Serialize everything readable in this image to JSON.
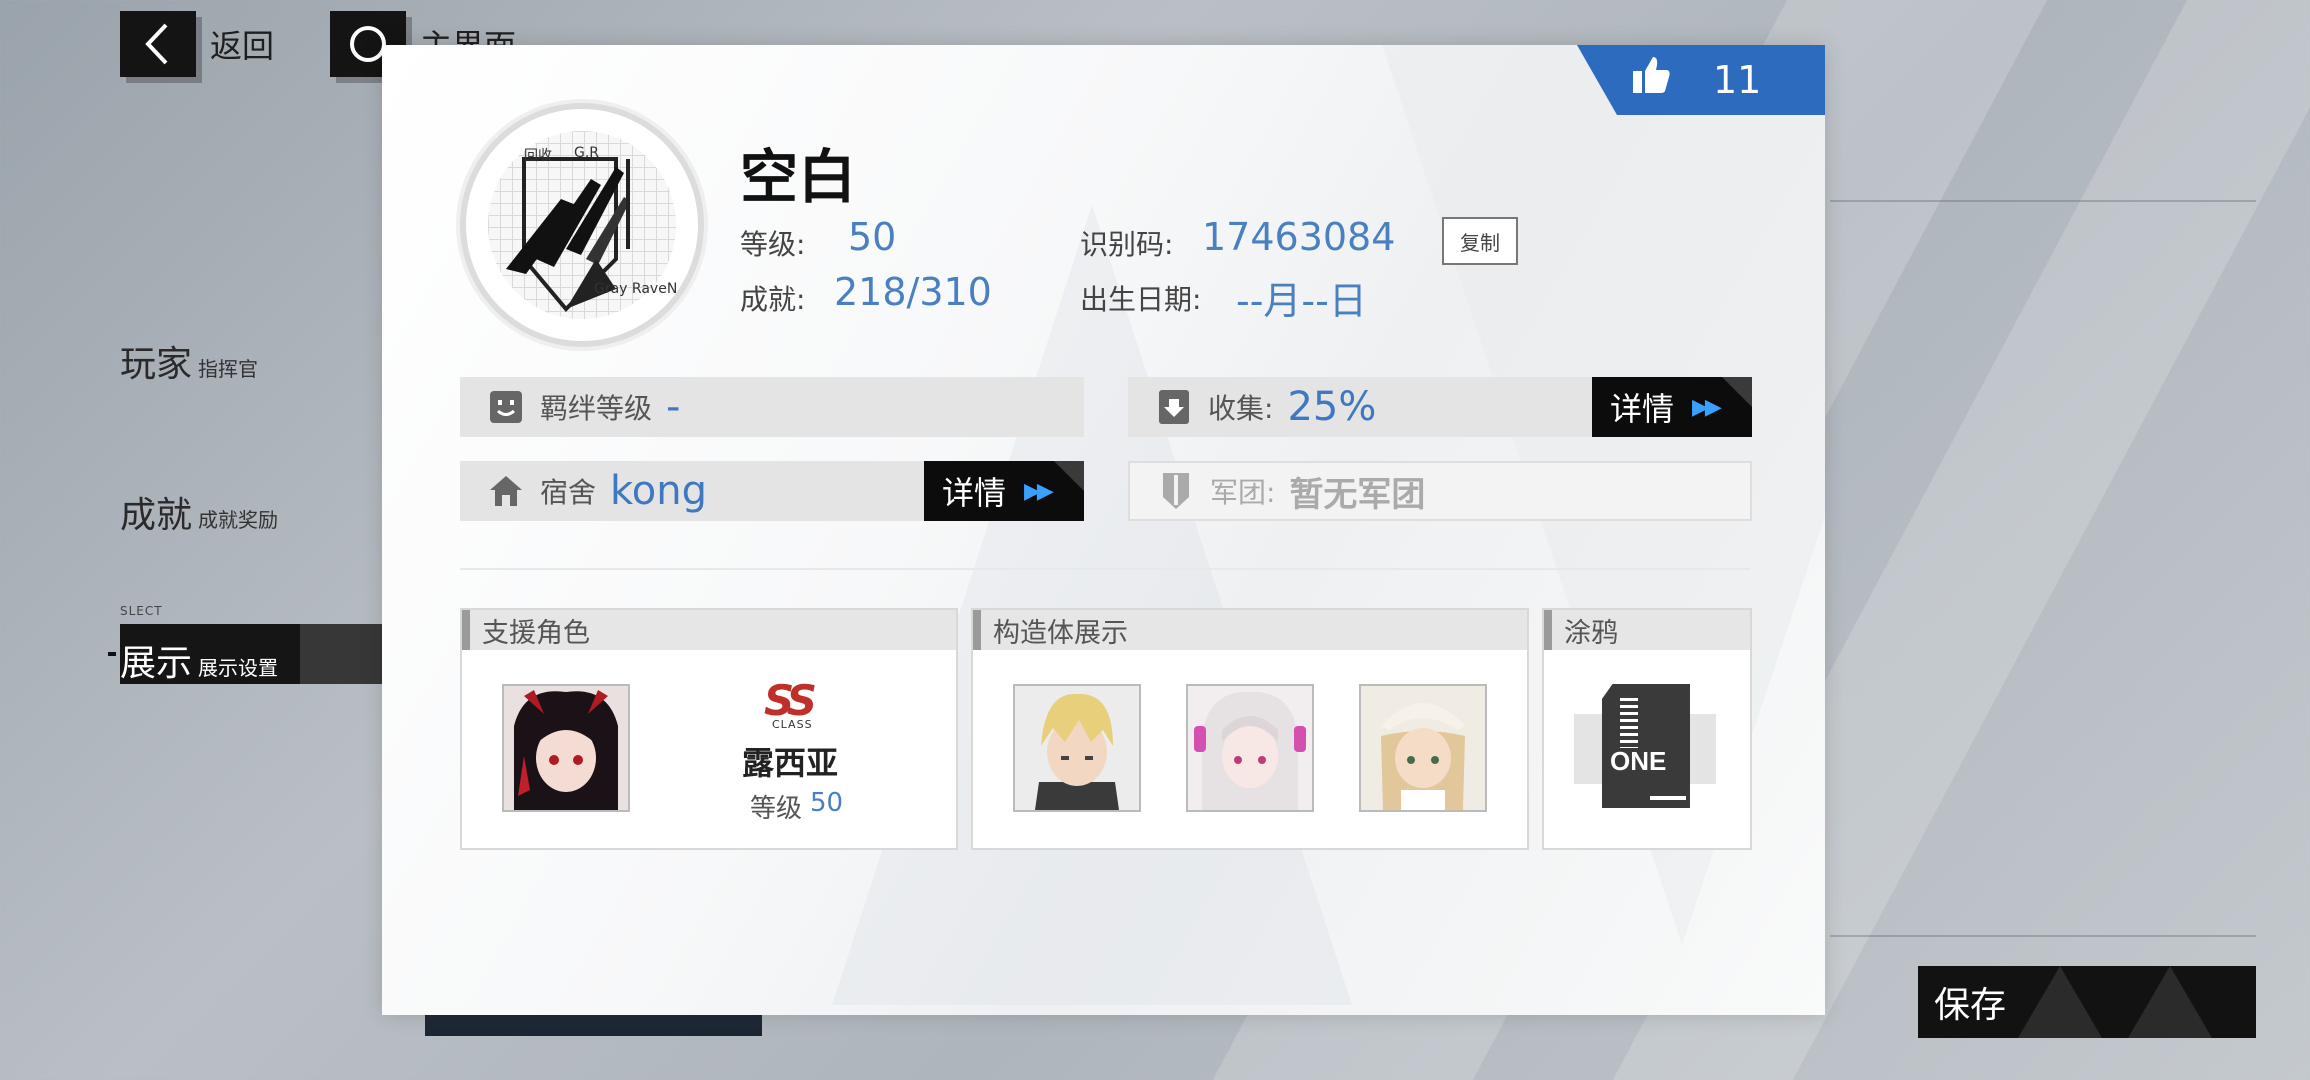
{
  "nav": {
    "back_label": "返回",
    "home_label": "主界面"
  },
  "menu": {
    "items": [
      {
        "label": "玩家",
        "sub": "指挥官"
      },
      {
        "label": "成就",
        "sub": "成就奖励"
      },
      {
        "label": "展示",
        "sub": "展示设置"
      }
    ],
    "selected_tag": "SLECT"
  },
  "save_label": "保存",
  "profile": {
    "likes": "11",
    "name": "空白",
    "avatar_text": {
      "top_left": "回收",
      "top_mid": "G.R",
      "bottom": "Gray RaveN"
    },
    "level_label": "等级:",
    "level": "50",
    "id_label": "识别码:",
    "id": "17463084",
    "copy_label": "复制",
    "achievement_label": "成就:",
    "achievement": "218/310",
    "birthday_label": "出生日期:",
    "birthday": "--月--日"
  },
  "bars": {
    "bond": {
      "label": "羁绊等级",
      "value": "-"
    },
    "collect": {
      "label": "收集:",
      "value": "25%",
      "button": "详情"
    },
    "dorm": {
      "label": "宿舍",
      "value": "kong",
      "button": "详情"
    },
    "guild": {
      "label": "军团:",
      "value": "暂无军团"
    }
  },
  "sections": {
    "support": {
      "title": "支援角色",
      "class_logo": "SS",
      "class_sub": "CLASS",
      "name": "露西亚",
      "level_label": "等级",
      "level": "50"
    },
    "constructs": {
      "title": "构造体展示"
    },
    "graffiti": {
      "title": "涂鸦",
      "sticker_text": "ONE"
    }
  },
  "colors": {
    "accent_blue": "#2d6bbf",
    "value_blue": "#4a7fc0",
    "detail_arrow": "#3aa0ff"
  }
}
